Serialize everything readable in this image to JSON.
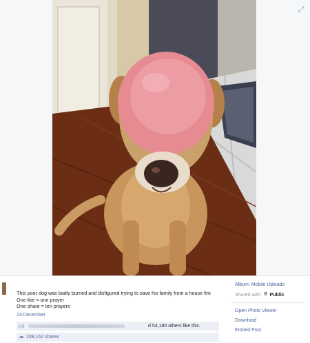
{
  "photo": {
    "subject": "dog-with-ham-slice-on-head"
  },
  "caption": {
    "lines": [
      "This poor dog was badly burned and disfigured trying to save his family from a house fire",
      "One like = one prayer",
      "One share = ten prayers"
    ]
  },
  "post": {
    "date": "23 December",
    "likes_text": "d 54,180 others like this.",
    "shares_text": "109,162 shares"
  },
  "sidebar": {
    "album": "Album: Mobile Uploads",
    "shared_with_label": "Shared with:",
    "shared_with_value": "Public",
    "actions": [
      "Open Photo Viewer",
      "Download",
      "Embed Post"
    ]
  },
  "icons": {
    "expand": "expand-icon",
    "like": "thumbs-up-icon",
    "share": "share-arrow-icon",
    "globe": "globe-icon"
  },
  "colors": {
    "link": "#4b67a1",
    "bar_background": "#eceff5",
    "muted": "#90949c"
  }
}
